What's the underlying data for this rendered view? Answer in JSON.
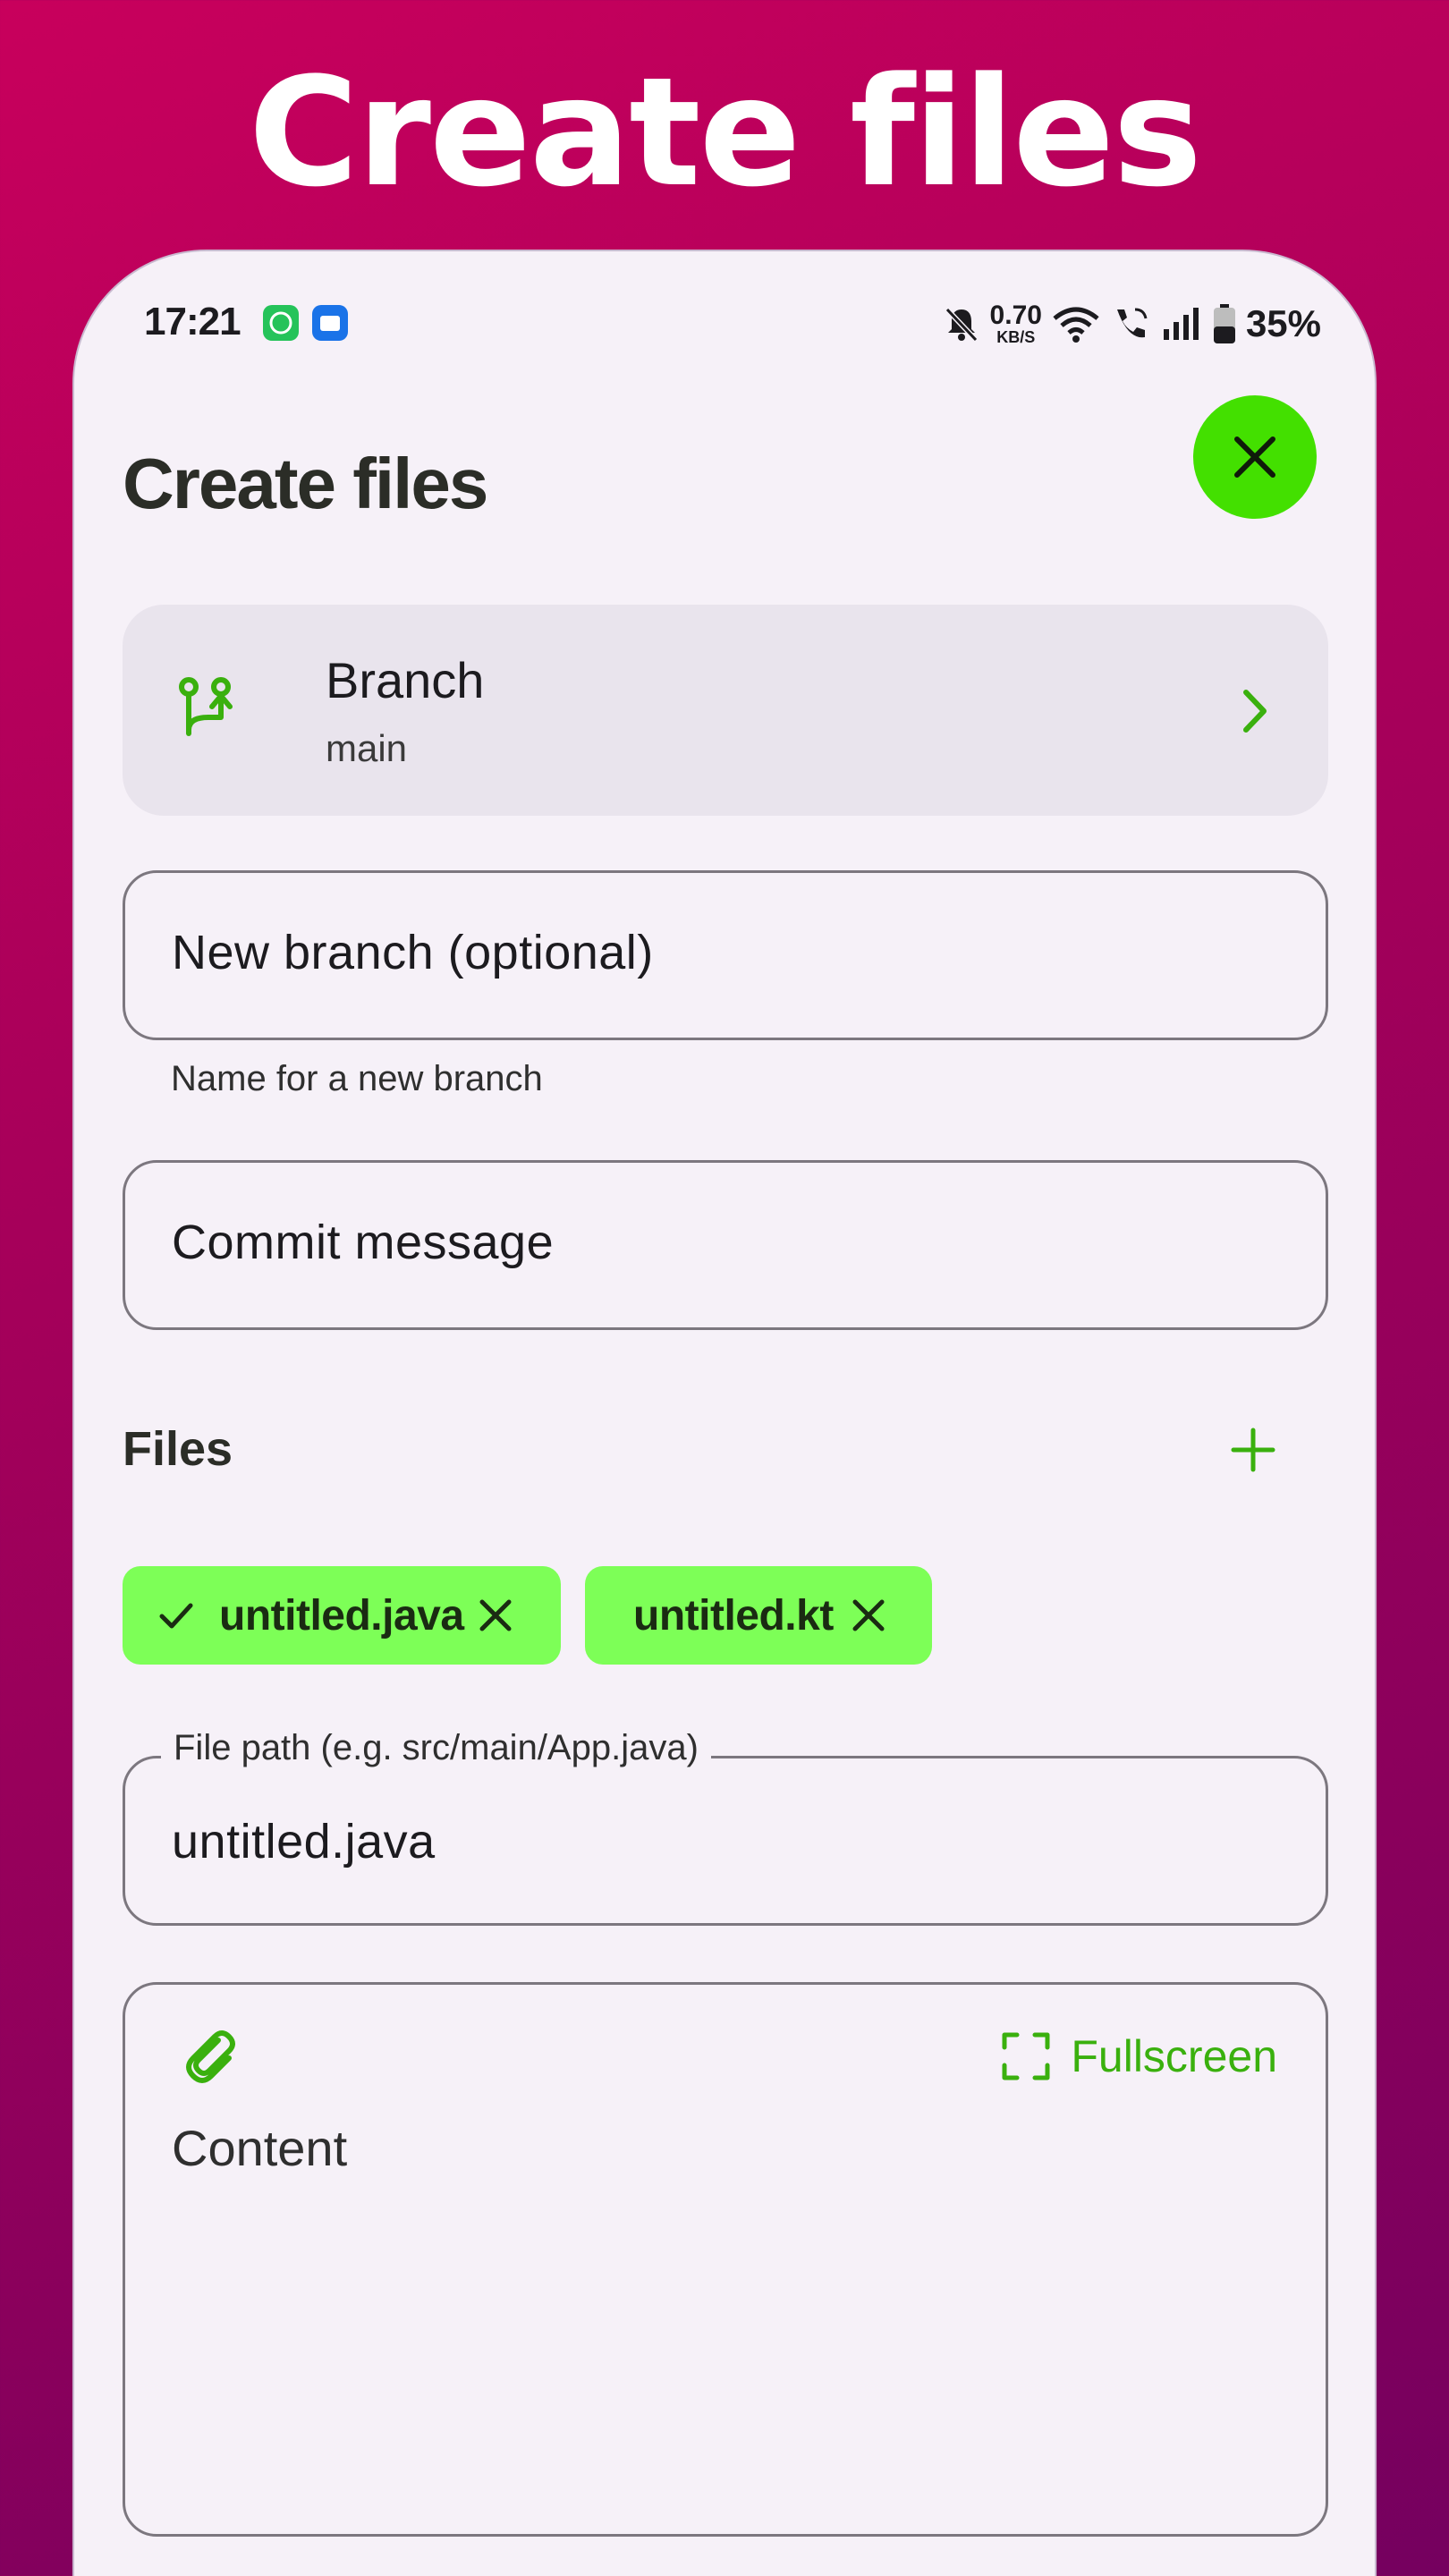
{
  "promo": {
    "title": "Create files"
  },
  "status_bar": {
    "time": "17:21",
    "network_speed_value": "0.70",
    "network_speed_unit": "KB/S",
    "battery": "35%",
    "icons": [
      "whatsapp-icon",
      "files-icon",
      "mute-icon",
      "wifi-icon",
      "wifi-call-icon",
      "signal-icon",
      "battery-icon"
    ]
  },
  "header": {
    "title": "Create files",
    "close_icon": "close-icon"
  },
  "branch": {
    "label": "Branch",
    "value": "main"
  },
  "new_branch": {
    "placeholder": "New branch (optional)",
    "helper": "Name for a new branch"
  },
  "commit": {
    "placeholder": "Commit message"
  },
  "files": {
    "label": "Files",
    "add_icon": "plus-icon",
    "tabs": [
      {
        "name": "untitled.java",
        "selected": true
      },
      {
        "name": "untitled.kt",
        "selected": false
      }
    ]
  },
  "file_path": {
    "label": "File path (e.g. src/main/App.java)",
    "value": "untitled.java"
  },
  "content": {
    "placeholder": "Content",
    "fullscreen_label": "Fullscreen",
    "attach_icon": "attach-icon"
  },
  "colors": {
    "accent": "#43e000",
    "chip": "#7dff57",
    "icon_green": "#3ab00e",
    "background_top": "#c8005c",
    "background_bottom": "#75005f",
    "surface": "#f6f1f8"
  }
}
